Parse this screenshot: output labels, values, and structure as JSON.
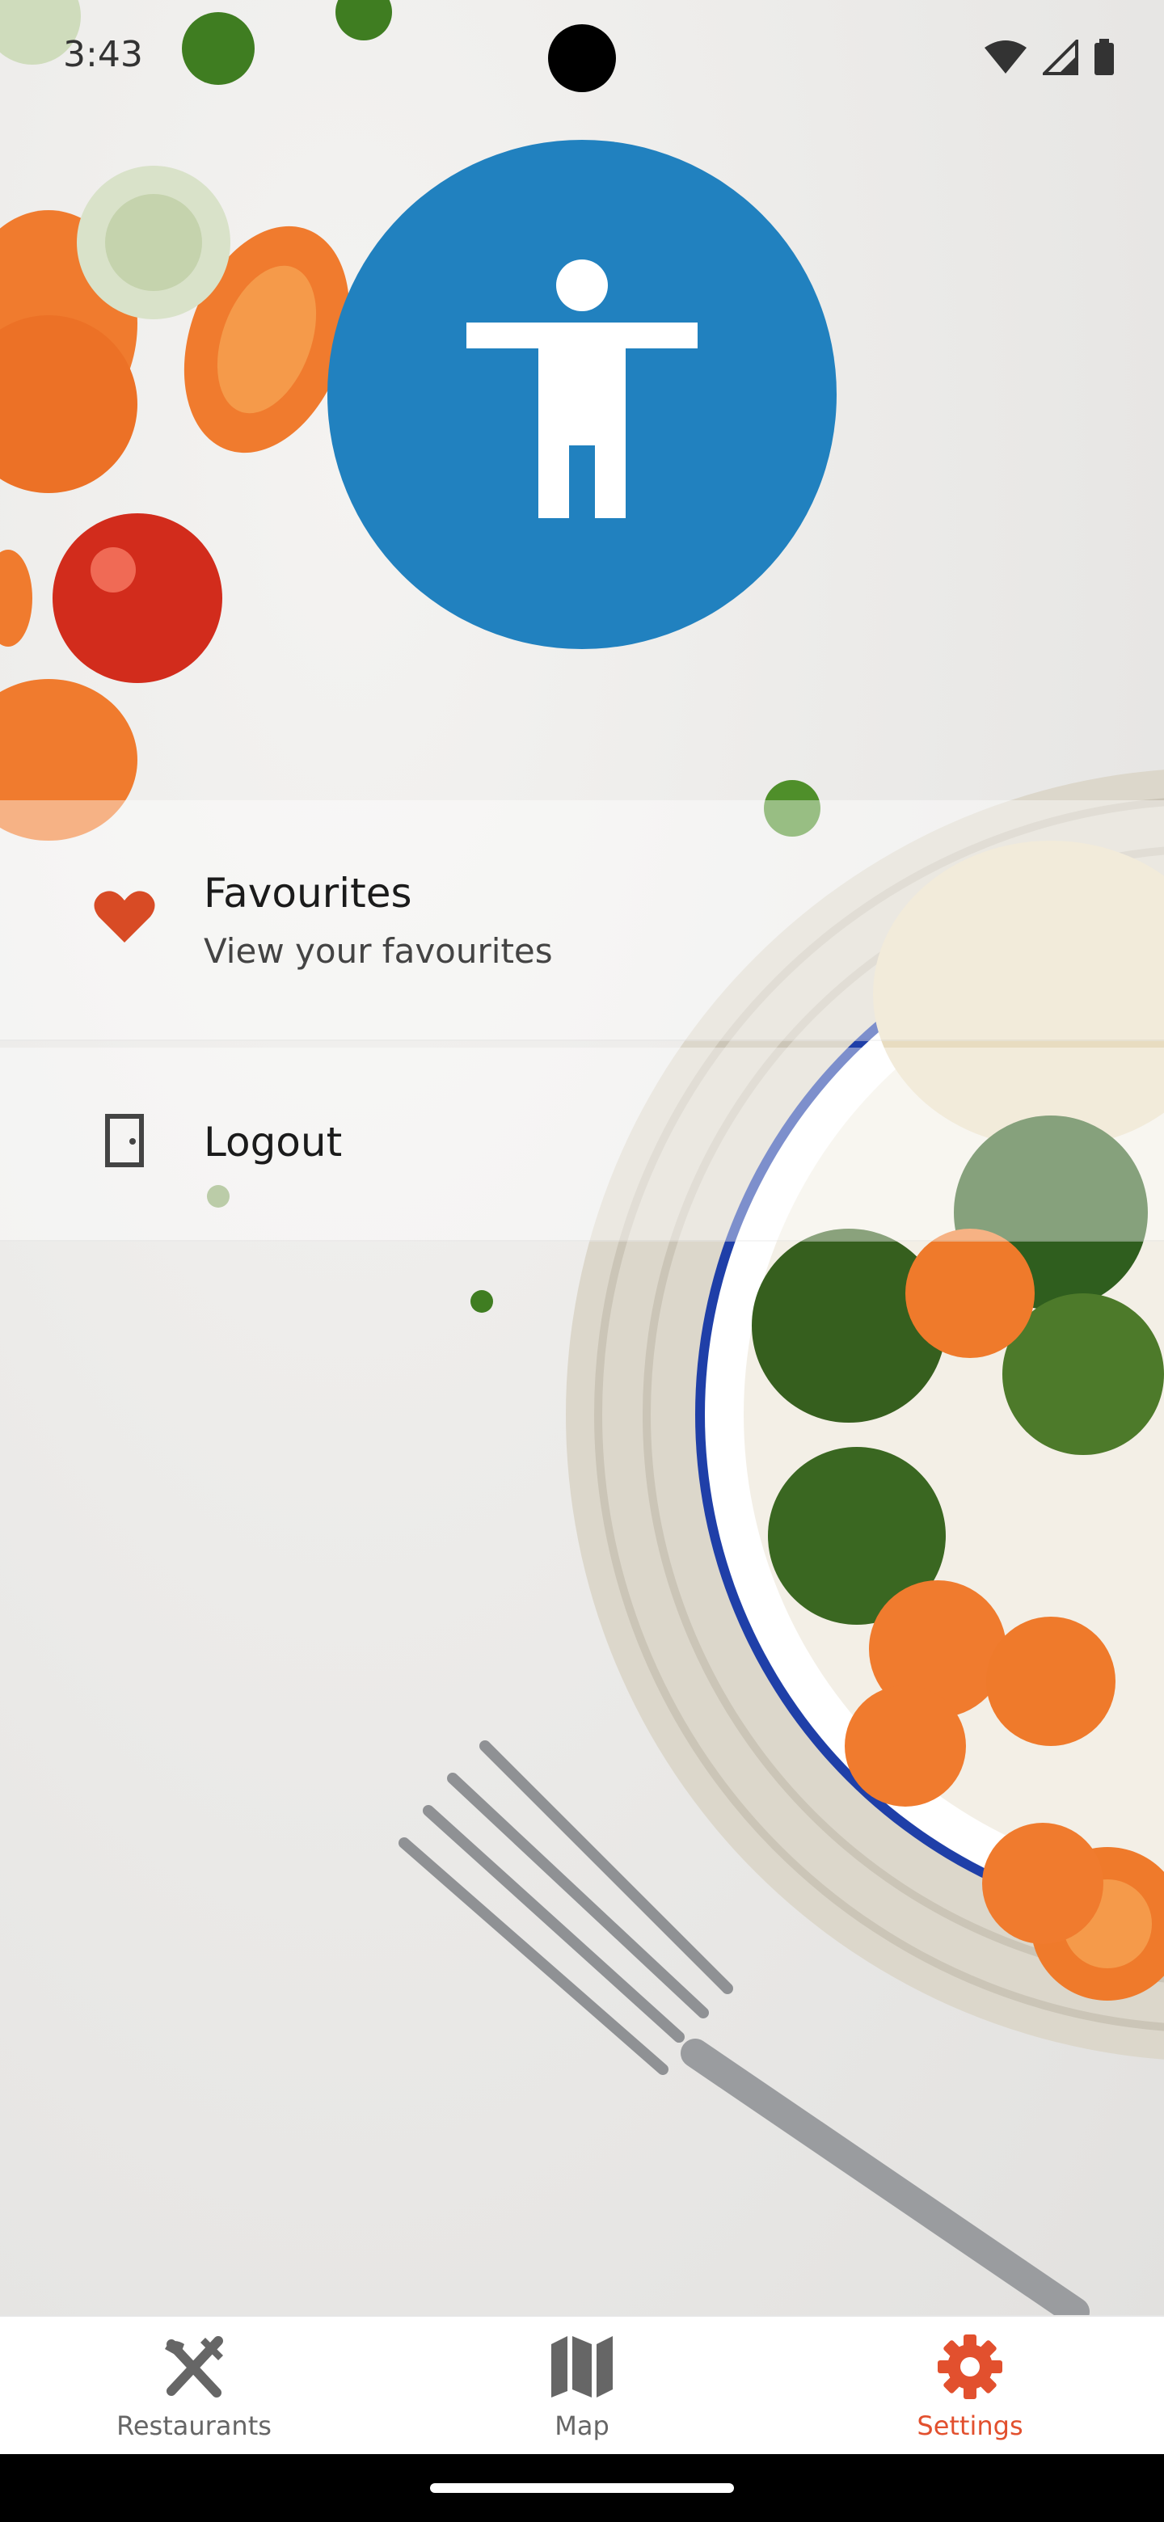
{
  "status_bar": {
    "time": "3:43",
    "icons": [
      "wifi-icon",
      "signal-icon",
      "battery-icon"
    ]
  },
  "profile": {
    "icon": "accessibility-icon",
    "color": "#2181bf"
  },
  "menu": {
    "favourites": {
      "title": "Favourites",
      "subtitle": "View your favourites",
      "icon": "heart-icon",
      "icon_color": "#d84b25"
    },
    "logout": {
      "title": "Logout",
      "icon": "door-icon"
    }
  },
  "bottom_nav": {
    "active_color": "#e2502e",
    "tabs": [
      {
        "label": "Restaurants",
        "icon": "utensils-icon",
        "active": false
      },
      {
        "label": "Map",
        "icon": "map-icon",
        "active": false
      },
      {
        "label": "Settings",
        "icon": "gear-icon",
        "active": true
      }
    ]
  }
}
